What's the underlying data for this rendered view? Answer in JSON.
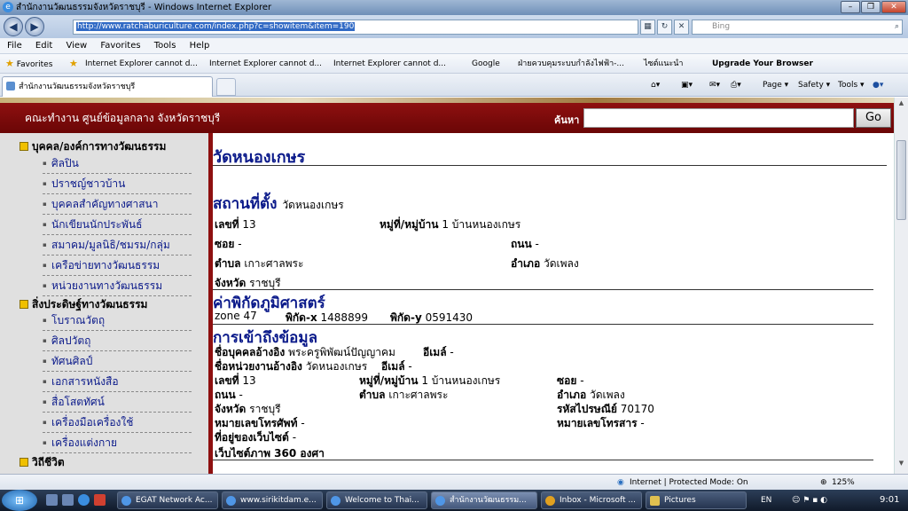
{
  "browser": {
    "title": "สำนักงานวัฒนธรรมจังหวัดราชบุรี - Windows Internet Explorer",
    "url": "http://www.ratchaburiculture.com/index.php?c=showitem&item=190",
    "search_placeholder": "Bing",
    "menu": [
      "File",
      "Edit",
      "View",
      "Favorites",
      "Tools",
      "Help"
    ],
    "favorites_label": "Favorites",
    "favorites": [
      "Internet Explorer cannot d...",
      "Internet Explorer cannot d...",
      "Internet Explorer cannot d...",
      "Google",
      "ฝ่ายควบคุมระบบกำลังไฟฟ้า-...",
      "ไซต์แนะนำ",
      "Upgrade Your Browser"
    ],
    "tab_title": "สำนักงานวัฒนธรรมจังหวัดราชบุรี",
    "commands": {
      "page": "Page",
      "safety": "Safety",
      "tools": "Tools"
    },
    "status": "Internet | Protected Mode: On",
    "zoom": "125%"
  },
  "site": {
    "header_title": "คณะทำงาน ศูนย์ข้อมูลกลาง จังหวัดราชบุรี",
    "search_label": "ค้นหา",
    "go_label": "Go"
  },
  "sidebar": {
    "cat1": "บุคคล/องค์การทางวัฒนธรรม",
    "cat1_items": [
      "ศิลปิน",
      "ปราชญ์ชาวบ้าน",
      "บุคคลสำคัญทางศาสนา",
      "นักเขียนนักประพันธ์",
      "สมาคม/มูลนิธิ/ชมรม/กลุ่ม",
      "เครือข่ายทางวัฒนธรรม",
      "หน่วยงานทางวัฒนธรรม"
    ],
    "cat2": "สิ่งประดิษฐ์ทางวัฒนธรรม",
    "cat2_items": [
      "โบราณวัตถุ",
      "ศิลปวัตถุ",
      "ทัศนศิลป์",
      "เอกสารหนังสือ",
      "สื่อโสตทัศน์",
      "เครื่องมือเครื่องใช้",
      "เครื่องแต่งกาย"
    ],
    "cat3": "วิถีชีวิต"
  },
  "main": {
    "title": "วัดหนองเกษร",
    "location_heading": "สถานที่ตั้ง",
    "location_name": "วัดหนองเกษร",
    "house_no_label": "เลขที่",
    "house_no": "13",
    "village_label": "หมู่ที่/หมู่บ้าน",
    "village": "1 บ้านหนองเกษร",
    "soi_label": "ซอย",
    "soi": "-",
    "road_label": "ถนน",
    "road": "-",
    "subdistrict_label": "ตำบล",
    "subdistrict": "เกาะศาลพระ",
    "district_label": "อำเภอ",
    "district": "วัดเพลง",
    "province_label": "จังหวัด",
    "province": "ราชบุรี",
    "geo_heading": "ค่าพิกัดภูมิศาสตร์",
    "zone_label": "zone",
    "zone": "47",
    "x_label": "พิกัด-x",
    "x": "1488899",
    "y_label": "พิกัด-y",
    "y": "0591430",
    "access_heading": "การเข้าถึงข้อมูล",
    "ref_person_label": "ชื่อบุคคลอ้างอิง",
    "ref_person": "พระครูพิพัฒน์ปัญญาคม",
    "email_label": "อีเมล์",
    "email": "-",
    "ref_org_label": "ชื่อหน่วยงานอ้างอิง",
    "ref_org": "วัดหนองเกษร",
    "email2": "-",
    "postal_label": "รหัสไปรษณีย์",
    "postal": "70170",
    "phone_label": "หมายเลขโทรศัพท์",
    "phone": "-",
    "fax_label": "หมายเลขโทรสาร",
    "fax": "-",
    "website_label": "ที่อยู่ของเว็บไซต์",
    "website": "-",
    "photo360_label": "เว็บไซต์ภาพ 360 องศา"
  },
  "taskbar": {
    "items": [
      "EGAT Network Ac...",
      "www.sirikitdam.e...",
      "Welcome to Thai...",
      "สำนักงานวัฒนธรรม...",
      "Inbox - Microsoft ...",
      "Pictures"
    ],
    "lang": "EN",
    "clock": "9:01"
  }
}
